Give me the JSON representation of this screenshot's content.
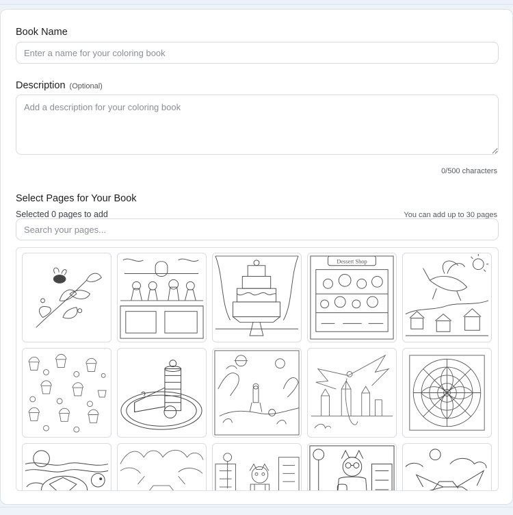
{
  "form": {
    "book_name_label": "Book Name",
    "book_name_placeholder": "Enter a name for your coloring book",
    "book_name_value": "",
    "description_label": "Description",
    "description_optional": "(Optional)",
    "description_placeholder": "Add a description for your coloring book",
    "description_value": "",
    "char_counter": "0/500 characters"
  },
  "pages_section": {
    "title": "Select Pages for Your Book",
    "selected_text": "Selected 0 pages to add",
    "limit_text": "You can add up to 30 pages",
    "search_placeholder": "Search your pages..."
  },
  "thumbnails": [
    {
      "name": "bee-flower",
      "sign": ""
    },
    {
      "name": "ice-cream-parlor",
      "sign": ""
    },
    {
      "name": "tiered-cake-window",
      "sign": ""
    },
    {
      "name": "dessert-shop",
      "sign": "Dessert Shop"
    },
    {
      "name": "unicorn-village",
      "sign": ""
    },
    {
      "name": "cupcake-pattern",
      "sign": ""
    },
    {
      "name": "cake-stack-plate",
      "sign": ""
    },
    {
      "name": "space-forest-explorer",
      "sign": ""
    },
    {
      "name": "dragon-castle",
      "sign": ""
    },
    {
      "name": "mandala",
      "sign": ""
    },
    {
      "name": "sea-turtle",
      "sign": ""
    },
    {
      "name": "pagoda-trees",
      "sign": ""
    },
    {
      "name": "cat-city-street",
      "sign": ""
    },
    {
      "name": "cat-glasses-street",
      "sign": ""
    },
    {
      "name": "flying-car",
      "sign": ""
    }
  ],
  "colors": {
    "border": "#d6d9de",
    "text": "#1d1d1f",
    "muted": "#55595f",
    "line_art": "#555555"
  }
}
